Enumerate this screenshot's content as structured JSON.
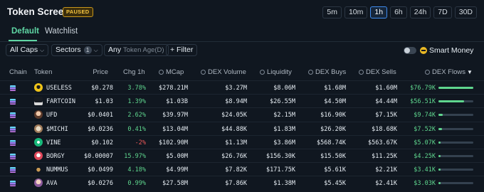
{
  "app": {
    "title": "Token Screener",
    "status_badge": "PAUSED"
  },
  "timeframes": [
    {
      "label": "5m",
      "active": false
    },
    {
      "label": "10m",
      "active": false
    },
    {
      "label": "1h",
      "active": true
    },
    {
      "label": "6h",
      "active": false
    },
    {
      "label": "24h",
      "active": false
    },
    {
      "label": "7D",
      "active": false
    },
    {
      "label": "30D",
      "active": false
    }
  ],
  "tabs": [
    {
      "label": "Default",
      "active": true
    },
    {
      "label": "Watchlist",
      "active": false
    }
  ],
  "filters": {
    "caps": "All Caps",
    "sectors": "Sectors",
    "sectors_count": "1",
    "age_prefix": "Any",
    "age_label": "Token Age(D)",
    "add_filter": "+ Filter",
    "smart_money": "Smart Money",
    "smart_money_on": false
  },
  "columns": {
    "chain": "Chain",
    "token": "Token",
    "price": "Price",
    "chg": "Chg 1h",
    "mcap": "MCap",
    "dex_volume": "DEX Volume",
    "liquidity": "Liquidity",
    "dex_buys": "DEX Buys",
    "dex_sells": "DEX Sells",
    "dex_flows": "DEX Flows"
  },
  "colors": {
    "accent": "#5fd6a4",
    "positive": "#5fd68e",
    "negative": "#f05a5a",
    "background": "#101720"
  },
  "rows": [
    {
      "chain_icon": "solana-icon",
      "token_icon": "useless-logo-icon",
      "symbol": "USELESS",
      "price": "$0.278",
      "chg": "3.78%",
      "chg_dir": "pos",
      "mcap": "$278.21M",
      "dex_volume": "$3.27M",
      "liquidity": "$8.06M",
      "dex_buys": "$1.68M",
      "dex_sells": "$1.60M",
      "dex_flows": "$76.79K",
      "flow_fraction": 1.0
    },
    {
      "chain_icon": "solana-icon",
      "token_icon": "fartcoin-logo-icon",
      "symbol": "FARTCOIN",
      "price": "$1.03",
      "chg": "1.39%",
      "chg_dir": "pos",
      "mcap": "$1.03B",
      "dex_volume": "$8.94M",
      "liquidity": "$26.55M",
      "dex_buys": "$4.50M",
      "dex_sells": "$4.44M",
      "dex_flows": "$56.51K",
      "flow_fraction": 0.74
    },
    {
      "chain_icon": "solana-icon",
      "token_icon": "ufd-logo-icon",
      "symbol": "UFD",
      "price": "$0.0401",
      "chg": "2.62%",
      "chg_dir": "pos",
      "mcap": "$39.97M",
      "dex_volume": "$24.05K",
      "liquidity": "$2.15M",
      "dex_buys": "$16.90K",
      "dex_sells": "$7.15K",
      "dex_flows": "$9.74K",
      "flow_fraction": 0.13
    },
    {
      "chain_icon": "solana-icon",
      "token_icon": "michi-logo-icon",
      "symbol": "$MICHI",
      "price": "$0.0236",
      "chg": "0.41%",
      "chg_dir": "pos",
      "mcap": "$13.04M",
      "dex_volume": "$44.88K",
      "liquidity": "$1.83M",
      "dex_buys": "$26.20K",
      "dex_sells": "$18.68K",
      "dex_flows": "$7.52K",
      "flow_fraction": 0.1
    },
    {
      "chain_icon": "solana-icon",
      "token_icon": "vine-logo-icon",
      "symbol": "VINE",
      "price": "$0.102",
      "chg": "-2%",
      "chg_dir": "neg",
      "mcap": "$102.90M",
      "dex_volume": "$1.13M",
      "liquidity": "$3.86M",
      "dex_buys": "$568.74K",
      "dex_sells": "$563.67K",
      "dex_flows": "$5.07K",
      "flow_fraction": 0.07
    },
    {
      "chain_icon": "solana-icon",
      "token_icon": "borgy-logo-icon",
      "symbol": "BORGY",
      "price": "$0.00007",
      "chg": "15.97%",
      "chg_dir": "pos",
      "mcap": "$5.00M",
      "dex_volume": "$26.76K",
      "liquidity": "$156.30K",
      "dex_buys": "$15.50K",
      "dex_sells": "$11.25K",
      "dex_flows": "$4.25K",
      "flow_fraction": 0.055
    },
    {
      "chain_icon": "solana-icon",
      "token_icon": "nummus-logo-icon",
      "symbol": "NUMMUS",
      "price": "$0.0499",
      "chg": "4.18%",
      "chg_dir": "pos",
      "mcap": "$4.99M",
      "dex_volume": "$7.82K",
      "liquidity": "$171.75K",
      "dex_buys": "$5.61K",
      "dex_sells": "$2.21K",
      "dex_flows": "$3.41K",
      "flow_fraction": 0.045
    },
    {
      "chain_icon": "solana-icon",
      "token_icon": "ava-logo-icon",
      "symbol": "AVA",
      "price": "$0.0276",
      "chg": "0.99%",
      "chg_dir": "pos",
      "mcap": "$27.58M",
      "dex_volume": "$7.86K",
      "liquidity": "$1.38M",
      "dex_buys": "$5.45K",
      "dex_sells": "$2.41K",
      "dex_flows": "$3.03K",
      "flow_fraction": 0.04
    }
  ]
}
